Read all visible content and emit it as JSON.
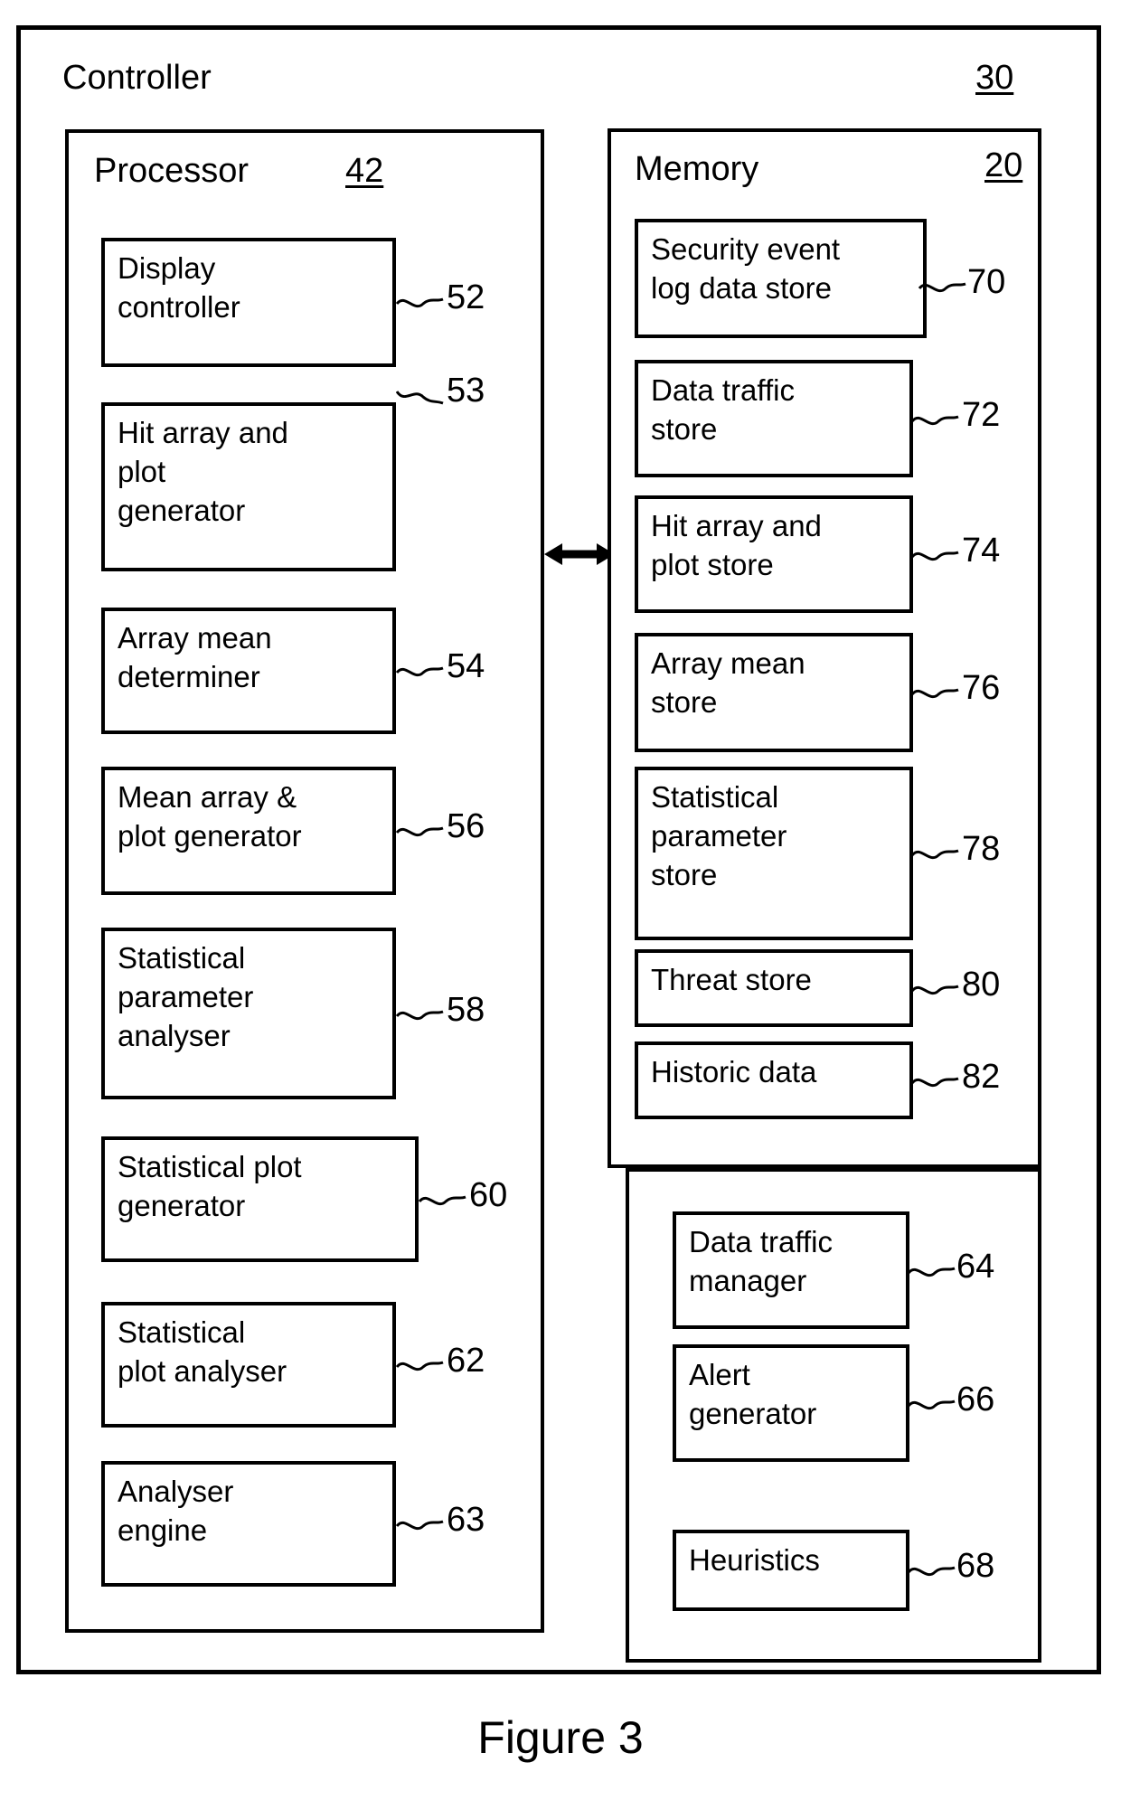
{
  "figure": {
    "caption": "Figure 3"
  },
  "controller": {
    "title": "Controller",
    "ref": "30"
  },
  "processor": {
    "title": "Processor",
    "ref": "42",
    "blocks": [
      {
        "label": "Display\ncontroller",
        "ref": "52"
      },
      {
        "label": "Hit array and\nplot\ngenerator",
        "ref": "53"
      },
      {
        "label": "Array mean\ndeterminer",
        "ref": "54"
      },
      {
        "label": "Mean array &\nplot generator",
        "ref": "56"
      },
      {
        "label": "Statistical\nparameter\nanalyser",
        "ref": "58"
      },
      {
        "label": "Statistical plot\ngenerator",
        "ref": "60"
      },
      {
        "label": "Statistical\nplot analyser",
        "ref": "62"
      },
      {
        "label": "Analyser\nengine",
        "ref": "63"
      }
    ]
  },
  "memory": {
    "title": "Memory",
    "ref": "20",
    "blocks": [
      {
        "label": "Security event\nlog data store",
        "ref": "70"
      },
      {
        "label": "Data traffic\nstore",
        "ref": "72"
      },
      {
        "label": "Hit array and\nplot store",
        "ref": "74"
      },
      {
        "label": "Array mean\nstore",
        "ref": "76"
      },
      {
        "label": "Statistical\nparameter\nstore",
        "ref": "78"
      },
      {
        "label": "Threat store",
        "ref": "80"
      },
      {
        "label": "Historic data",
        "ref": "82"
      }
    ]
  },
  "services": {
    "blocks": [
      {
        "label": "Data traffic\nmanager",
        "ref": "64"
      },
      {
        "label": "Alert\ngenerator",
        "ref": "66"
      },
      {
        "label": "Heuristics",
        "ref": "68"
      }
    ]
  },
  "connector": {
    "name": "processor-memory-bus",
    "direction": "bidirectional"
  },
  "colors": {
    "ink": "#000000",
    "paper": "#ffffff"
  }
}
